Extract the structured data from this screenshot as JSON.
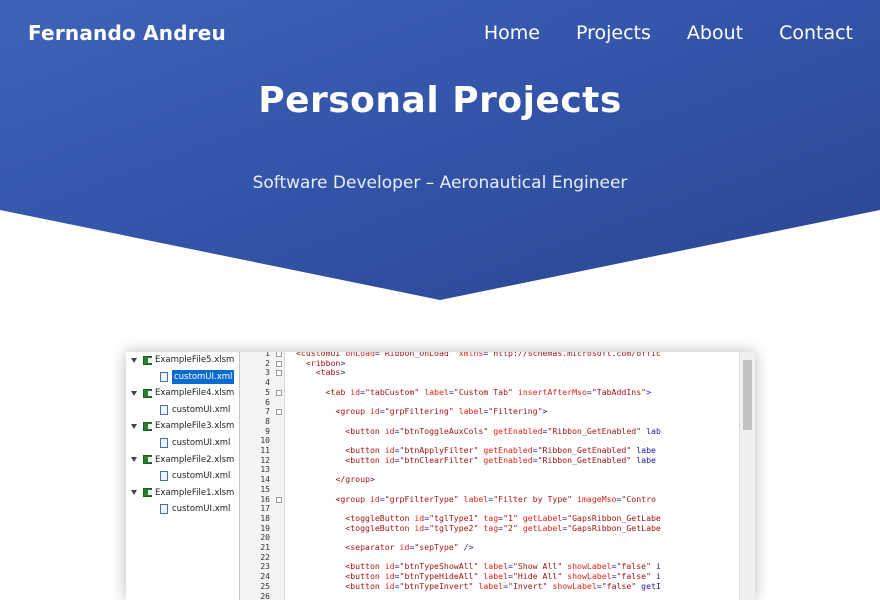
{
  "header": {
    "brand": "Fernando Andreu",
    "nav": [
      "Home",
      "Projects",
      "About",
      "Contact"
    ],
    "title": "Personal Projects",
    "subtitle": "Software Developer – Aeronautical Engineer"
  },
  "screenshot": {
    "tree": [
      {
        "label": "ExampleFile5.xlsm",
        "type": "workbook"
      },
      {
        "label": "customUI.xml",
        "type": "xml",
        "selected": true
      },
      {
        "label": "ExampleFile4.xlsm",
        "type": "workbook"
      },
      {
        "label": "customUI.xml",
        "type": "xml"
      },
      {
        "label": "ExampleFile3.xlsm",
        "type": "workbook"
      },
      {
        "label": "customUI.xml",
        "type": "xml"
      },
      {
        "label": "ExampleFile2.xlsm",
        "type": "workbook"
      },
      {
        "label": "customUI.xml",
        "type": "xml"
      },
      {
        "label": "ExampleFile1.xlsm",
        "type": "workbook"
      },
      {
        "label": "customUI.xml",
        "type": "xml"
      }
    ],
    "code_lines": [
      "<customUI onLoad=\"Ribbon_OnLoad\" xmlns=\"http://schemas.microsoft.com/offic",
      "  <ribbon>",
      "    <tabs>",
      "",
      "      <tab id=\"tabCustom\" label=\"Custom Tab\" insertAfterMso=\"TabAddIns\">",
      "",
      "        <group id=\"grpFiltering\" label=\"Filtering\">",
      "",
      "          <button id=\"btnToggleAuxCols\" getEnabled=\"Ribbon_GetEnabled\" lab",
      "",
      "          <button id=\"btnApplyFilter\" getEnabled=\"Ribbon_GetEnabled\" labe",
      "          <button id=\"btnClearFilter\" getEnabled=\"Ribbon_GetEnabled\" labe",
      "",
      "        </group>",
      "",
      "        <group id=\"grpFilterType\" label=\"Filter by Type\" imageMso=\"Contro",
      "",
      "          <toggleButton id=\"tglType1\" tag=\"1\" getLabel=\"GapsRibbon_GetLabe",
      "          <toggleButton id=\"tglType2\" tag=\"2\" getLabel=\"GapsRibbon_GetLabe",
      "",
      "          <separator id=\"sepType\" />",
      "",
      "          <button id=\"btnTypeShowAll\" label=\"Show All\" showLabel=\"false\" i",
      "          <button id=\"btnTypeHideAll\" label=\"Hide All\" showLabel=\"false\" i",
      "          <button id=\"btnTypeInvert\" label=\"Invert\" showLabel=\"false\" getI",
      ""
    ],
    "line_numbers": [
      "1",
      "2",
      "3",
      "4",
      "5",
      "6",
      "7",
      "8",
      "9",
      "10",
      "11",
      "12",
      "13",
      "14",
      "15",
      "16",
      "17",
      "18",
      "19",
      "20",
      "21",
      "22",
      "23",
      "24",
      "25",
      "26"
    ]
  }
}
